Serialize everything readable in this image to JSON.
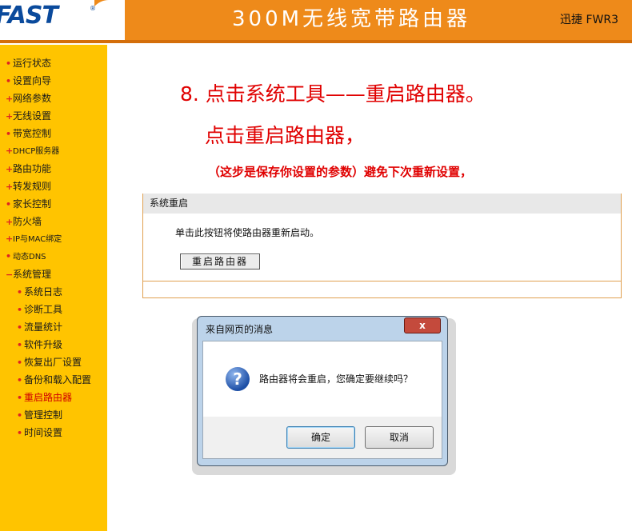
{
  "header": {
    "logo": "FAST",
    "title": "300M无线宽带路由器",
    "model": "迅捷 FWR3"
  },
  "sidebar": {
    "items": [
      {
        "label": "运行状态"
      },
      {
        "label": "设置向导"
      },
      {
        "label": "网络参数"
      },
      {
        "label": "无线设置"
      },
      {
        "label": "带宽控制"
      },
      {
        "label": "DHCP服务器"
      },
      {
        "label": "路由功能"
      },
      {
        "label": "转发规则"
      },
      {
        "label": "家长控制"
      },
      {
        "label": "防火墙"
      },
      {
        "label": "IP与MAC绑定"
      },
      {
        "label": "动态DNS"
      },
      {
        "label": "系统管理"
      }
    ],
    "subitems": [
      {
        "label": "系统日志"
      },
      {
        "label": "诊断工具"
      },
      {
        "label": "流量统计"
      },
      {
        "label": "软件升级"
      },
      {
        "label": "恢复出厂设置"
      },
      {
        "label": "备份和载入配置"
      },
      {
        "label": "重启路由器"
      },
      {
        "label": "管理控制"
      },
      {
        "label": "时间设置"
      }
    ]
  },
  "annotations": {
    "step": "8. 点击系统工具——重启路由器。",
    "click": "点击重启路由器，",
    "note": "（这步是保存你设置的参数）避免下次重新设置，"
  },
  "panel": {
    "title": "系统重启",
    "description": "单击此按钮将使路由器重新启动。",
    "button": "重启路由器"
  },
  "dialog": {
    "title": "来自网页的消息",
    "close": "x",
    "message": "路由器将会重启，您确定要继续吗？",
    "ok": "确定",
    "cancel": "取消"
  }
}
